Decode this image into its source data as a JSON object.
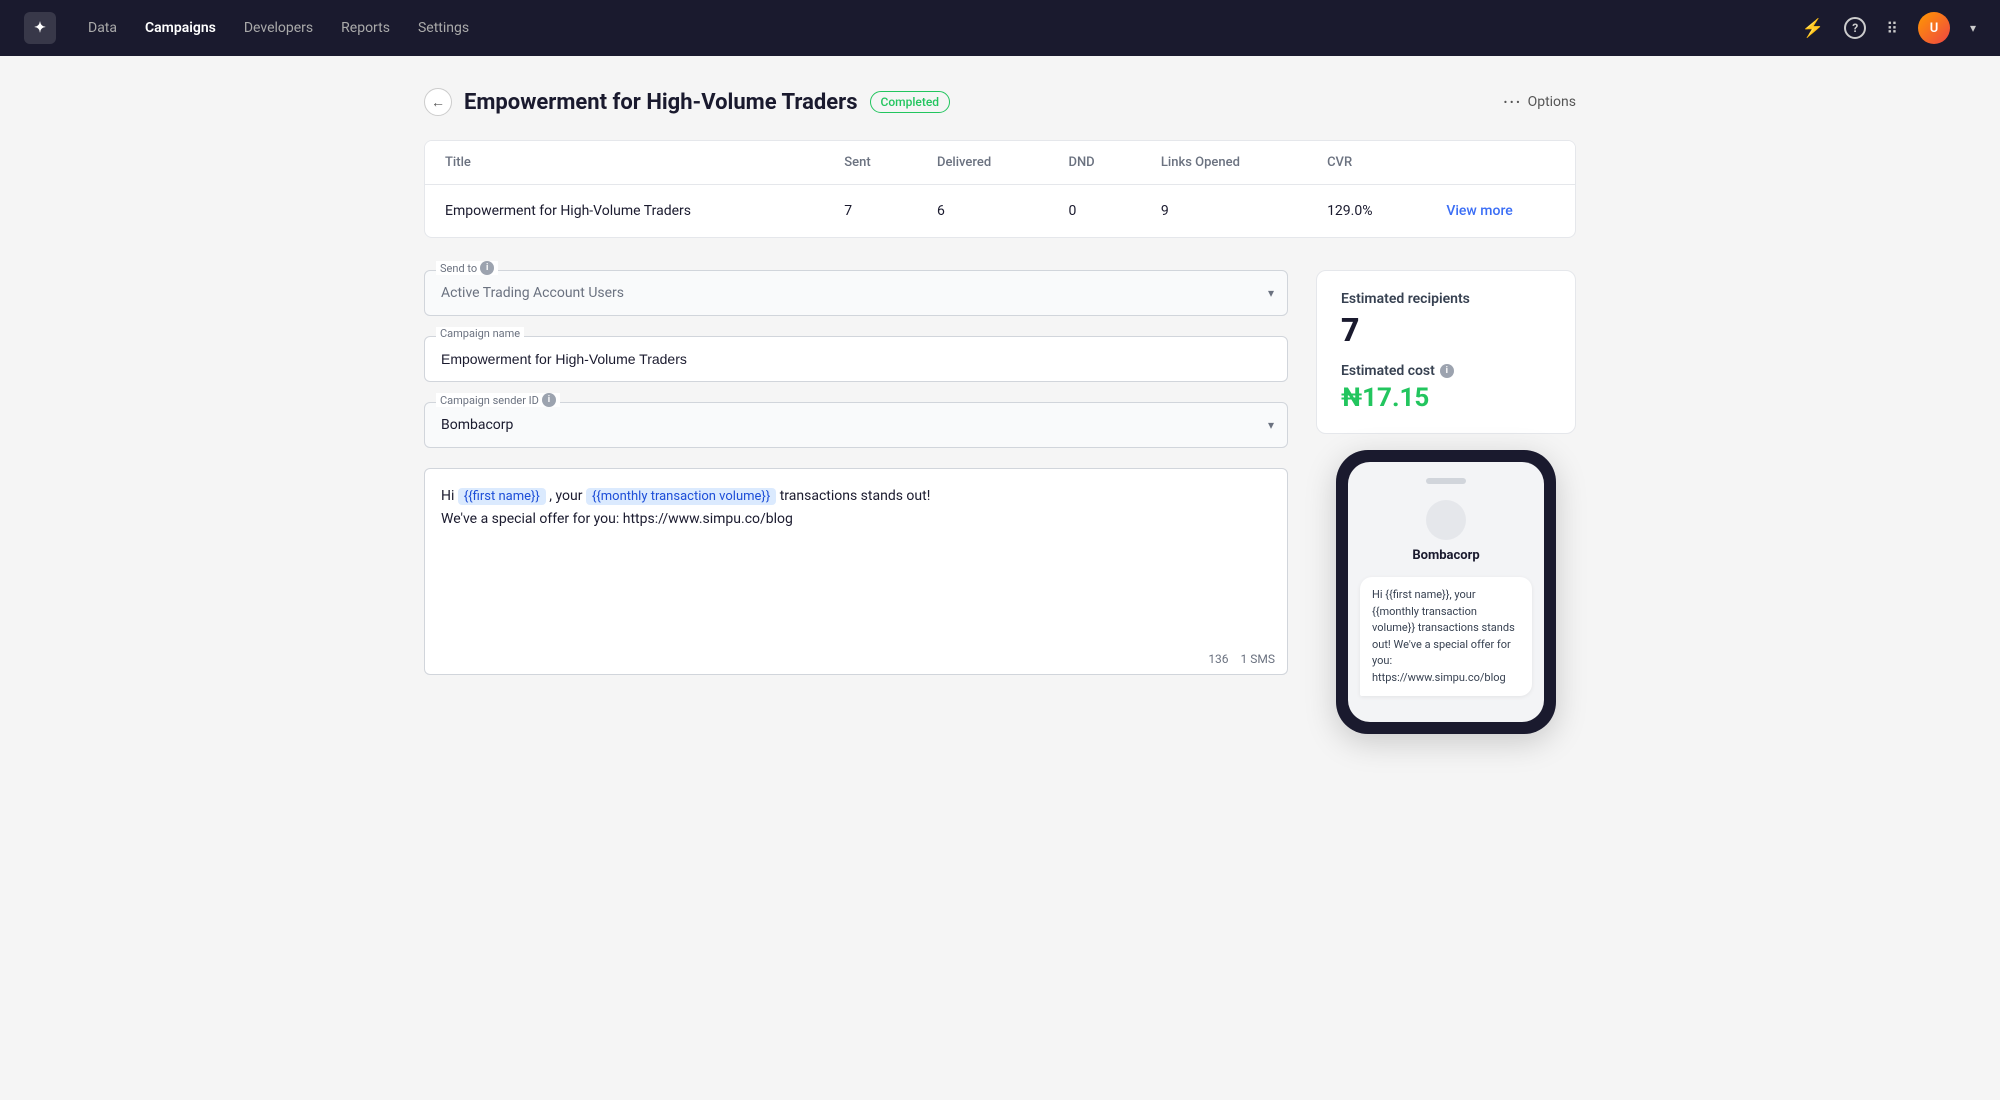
{
  "nav": {
    "logo": "✦",
    "links": [
      {
        "label": "Data",
        "active": false
      },
      {
        "label": "Campaigns",
        "active": true
      },
      {
        "label": "Developers",
        "active": false
      },
      {
        "label": "Reports",
        "active": false
      },
      {
        "label": "Settings",
        "active": false
      }
    ],
    "icons": {
      "bolt": "⚡",
      "help": "?",
      "grid": "⠿"
    },
    "avatar_initials": "U",
    "chevron": "▾"
  },
  "page": {
    "back_label": "←",
    "title": "Empowerment for High-Volume Traders",
    "status": "Completed",
    "options_label": "Options"
  },
  "table": {
    "columns": [
      "Title",
      "Sent",
      "Delivered",
      "DND",
      "Links Opened",
      "CVR",
      ""
    ],
    "rows": [
      {
        "title": "Empowerment for High-Volume Traders",
        "sent": "7",
        "delivered": "6",
        "dnd": "0",
        "links_opened": "9",
        "cvr": "129.0%",
        "action": "View more"
      }
    ]
  },
  "form": {
    "send_to_label": "Send to",
    "send_to_value": "Active Trading Account Users",
    "campaign_name_label": "Campaign name",
    "campaign_name_value": "Empowerment for High-Volume Traders",
    "sender_id_label": "Campaign sender ID",
    "sender_id_value": "Bombacorp",
    "sms_text_plain": "Hi {{first name}}, your {{monthly transaction volume}} transactions stands out! We've a special offer for you: https://www.simpu.co/blog",
    "sms_char_count": "136",
    "sms_count": "1 SMS"
  },
  "estimate": {
    "recipients_label": "Estimated recipients",
    "recipients_count": "7",
    "cost_label": "Estimated cost",
    "cost_value": "₦17.15"
  },
  "phone": {
    "sender_name": "Bombacorp",
    "message": "Hi {{first name}}, your {{monthly transaction volume}} transactions stands out! We've a special offer for you: https://www.simpu.co/blog"
  }
}
